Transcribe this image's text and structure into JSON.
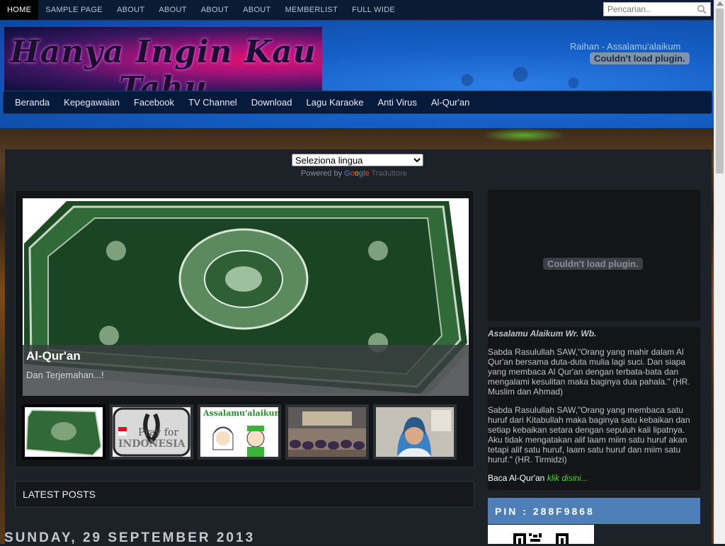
{
  "topnav": {
    "items": [
      {
        "label": "HOME",
        "active": true
      },
      {
        "label": "SAMPLE PAGE"
      },
      {
        "label": "ABOUT"
      },
      {
        "label": "ABOUT"
      },
      {
        "label": "ABOUT"
      },
      {
        "label": "ABOUT"
      },
      {
        "label": "MEMBERLIST"
      },
      {
        "label": "FULL WIDE"
      }
    ],
    "search_placeholder": "Pencarian.."
  },
  "header": {
    "logo_text": "Hanya Ingin Kau Tahu",
    "greeting": "Raihan - Assalamu'alaikum",
    "plugin_error": "Couldn't load plugin."
  },
  "mainnav": {
    "items": [
      "Beranda",
      "Kepegawaian",
      "Facebook",
      "TV Channel",
      "Download",
      "Lagu Karaoke",
      "Anti Virus",
      "Al-Qur'an"
    ]
  },
  "translate": {
    "selected": "Seleziona lingua",
    "powered": "Powered by",
    "google": [
      "G",
      "o",
      "o",
      "g",
      "l",
      "e"
    ],
    "traduttore": "Traduttore"
  },
  "slider": {
    "title": "Al-Qur'an",
    "subtitle": "Dan Terjemahan...!",
    "thumb_texts": [
      "Pray for",
      "INDONESIA",
      "Assalamu'alaikum"
    ]
  },
  "latest_posts": "LATEST POSTS",
  "post_date": "SUNDAY, 29 SEPTEMBER 2013",
  "sidebar": {
    "plugin_error": "Couldn't load plugin.",
    "heading": "Assalamu Alaikum Wr. Wb.",
    "para1": "Sabda Rasulullah SAW,\"Orang yang mahir dalam Al Qur'an bersama duta-duta mulia lagi suci. Dan siapa yang membaca Al Qur'an dengan terbata-bata dan mengalami kesulitan maka baginya dua pahala.\" (HR. Muslim dan Ahmad)",
    "para2": "Sabda Rasulullah SAW,\"Orang yang membaca satu huruf dari Kitabullah maka baginya satu kebaikan dan setiap kebaikan setara dengan sepuluh kali lipatnya. Aku tidak mengatakan alif laam miim satu huruf akan tetapi alif satu huruf, laam satu huruf dan miim satu huruf.\" (HR. Tirmidzi)",
    "baca": "Baca Al-Qur'an",
    "baca_link": "klik disini...",
    "pin": "PIN : 288F9868"
  }
}
